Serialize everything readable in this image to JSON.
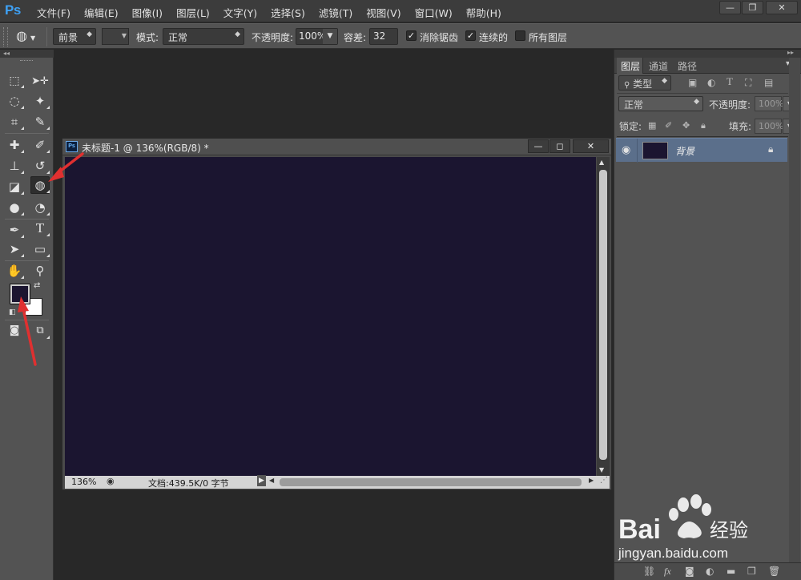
{
  "app": {
    "logo": "Ps",
    "menu": [
      "文件(F)",
      "编辑(E)",
      "图像(I)",
      "图层(L)",
      "文字(Y)",
      "选择(S)",
      "滤镜(T)",
      "视图(V)",
      "窗口(W)",
      "帮助(H)"
    ],
    "window_controls": [
      "—",
      "❐",
      "✕"
    ]
  },
  "options_bar": {
    "fill_source": "前景",
    "mode_label": "模式:",
    "mode_value": "正常",
    "opacity_label": "不透明度:",
    "opacity_value": "100%",
    "tolerance_label": "容差:",
    "tolerance_value": "32",
    "antialias_label": "消除锯齿",
    "antialias_checked": true,
    "contiguous_label": "连续的",
    "contiguous_checked": true,
    "all_layers_label": "所有图层",
    "all_layers_checked": false
  },
  "toolbar": {
    "tools": [
      {
        "name": "marquee-tool",
        "glyph": "⬚"
      },
      {
        "name": "move-tool",
        "glyph": "✥"
      },
      {
        "name": "lasso-tool",
        "glyph": "◌"
      },
      {
        "name": "magic-wand-tool",
        "glyph": "✦"
      },
      {
        "name": "crop-tool",
        "glyph": "⌗"
      },
      {
        "name": "eyedropper-tool",
        "glyph": "✎"
      },
      {
        "name": "healing-brush-tool",
        "glyph": "✚"
      },
      {
        "name": "brush-tool",
        "glyph": "✐"
      },
      {
        "name": "clone-stamp-tool",
        "glyph": "⊥"
      },
      {
        "name": "history-brush-tool",
        "glyph": "↺"
      },
      {
        "name": "eraser-tool",
        "glyph": "◪"
      },
      {
        "name": "paint-bucket-tool",
        "glyph": "◍"
      },
      {
        "name": "blur-tool",
        "glyph": "●"
      },
      {
        "name": "dodge-tool",
        "glyph": "◔"
      },
      {
        "name": "pen-tool",
        "glyph": "✒"
      },
      {
        "name": "type-tool",
        "glyph": "T"
      },
      {
        "name": "path-selection-tool",
        "glyph": "➤"
      },
      {
        "name": "rectangle-tool",
        "glyph": "▭"
      },
      {
        "name": "hand-tool",
        "glyph": "✋"
      },
      {
        "name": "zoom-tool",
        "glyph": "⚲"
      }
    ],
    "foreground_color": "#1b1530",
    "background_color": "#ffffff"
  },
  "document": {
    "title": "未标题-1 @ 136%(RGB/8) *",
    "canvas_color": "#1b1530",
    "zoom": "136%",
    "doc_info": "文档:439.5K/0 字节"
  },
  "layers_panel": {
    "tabs": [
      "图层",
      "通道",
      "路径"
    ],
    "active_tab": "图层",
    "filter_type": "类型",
    "blend_mode": "正常",
    "opacity_label": "不透明度:",
    "opacity_value": "100%",
    "lock_label": "锁定:",
    "fill_label": "填充:",
    "fill_value": "100%",
    "layer_name": "背景"
  },
  "watermark": {
    "brand": "Bai",
    "brand_suffix": "经验",
    "url": "jingyan.baidu.com"
  }
}
